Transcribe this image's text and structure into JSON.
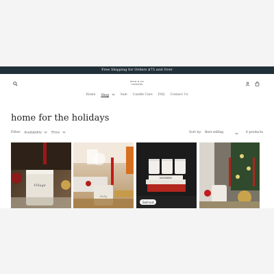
{
  "announcement": "Free Shipping for Orders $75 and Over",
  "logo": {
    "line1": "WILD & CO",
    "line2": "CANDLES"
  },
  "nav": {
    "items": [
      {
        "label": "Home"
      },
      {
        "label": "Shop",
        "active": true,
        "chevron": "chevron-down-icon"
      },
      {
        "label": "Sale"
      },
      {
        "label": "Candle Care"
      },
      {
        "label": "FAQ"
      },
      {
        "label": "Contact Us"
      }
    ]
  },
  "header_icons": [
    "search-icon",
    "account-icon",
    "cart-icon"
  ],
  "collection": {
    "title": "home for the holidays"
  },
  "filters": {
    "label": "Filter:",
    "availability": "Availability",
    "price": "Price",
    "sort_label": "Sort by:",
    "sort_value": "Best selling",
    "count": "6 products"
  },
  "products": [
    {
      "badge": ""
    },
    {
      "badge": ""
    },
    {
      "badge": "Sold out"
    },
    {
      "badge": ""
    }
  ]
}
